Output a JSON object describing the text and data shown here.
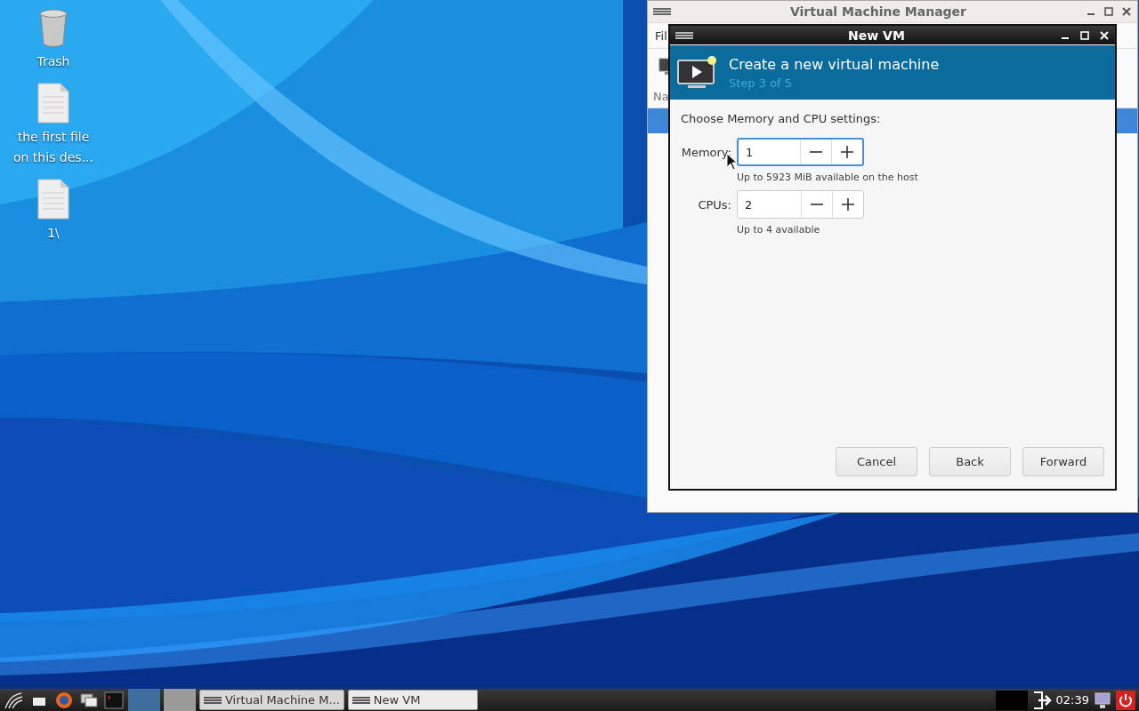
{
  "desktop_icons": [
    {
      "kind": "trash",
      "lines": [
        "Trash"
      ]
    },
    {
      "kind": "file",
      "lines": [
        "the first file",
        "on this des..."
      ]
    },
    {
      "kind": "file",
      "lines": [
        "1\\"
      ]
    }
  ],
  "back_window": {
    "title": "Virtual Machine Manager",
    "menu_label": "Fil",
    "column_label": "Na",
    "rows": [
      {
        "selected": true
      }
    ]
  },
  "dialog": {
    "title": "New VM",
    "header": {
      "title": "Create a new virtual machine",
      "step": "Step 3 of 5"
    },
    "prompt": "Choose Memory and CPU settings:",
    "fields": [
      {
        "label": "Memory:",
        "value": "1",
        "focused": true,
        "hint": "Up to 5923 MiB available on the host"
      },
      {
        "label": "CPUs:",
        "value": "2",
        "focused": false,
        "hint": "Up to 4 available"
      }
    ],
    "buttons": [
      "Cancel",
      "Back",
      "Forward"
    ]
  },
  "taskbar": {
    "launchers": [
      {
        "kind": "menu"
      },
      {
        "kind": "folder"
      },
      {
        "kind": "browser"
      },
      {
        "kind": "windows"
      },
      {
        "kind": "terminal"
      }
    ],
    "workspaces": [
      {
        "selected": true
      },
      {
        "selected": false
      }
    ],
    "tasks": [
      {
        "label": "Virtual Machine M...",
        "selected": false
      },
      {
        "label": "New VM",
        "selected": true
      }
    ],
    "clock": "02:39"
  }
}
